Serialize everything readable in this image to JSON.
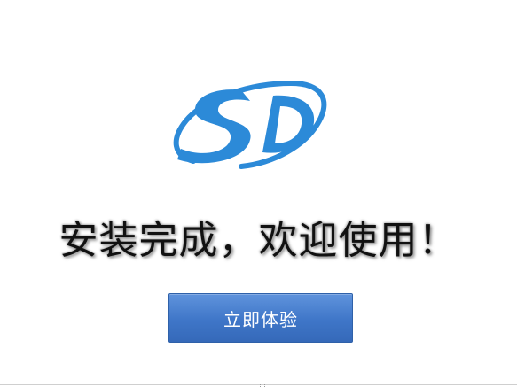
{
  "brand": {
    "logo_text": "SD",
    "logo_color": "#2c8ad8",
    "logo_icon": "sd-logo-icon"
  },
  "main": {
    "headline": "安装完成，欢迎使用！",
    "start_button_label": "立即体验",
    "button_color": "#3f76c8",
    "text_color": "#111111"
  }
}
